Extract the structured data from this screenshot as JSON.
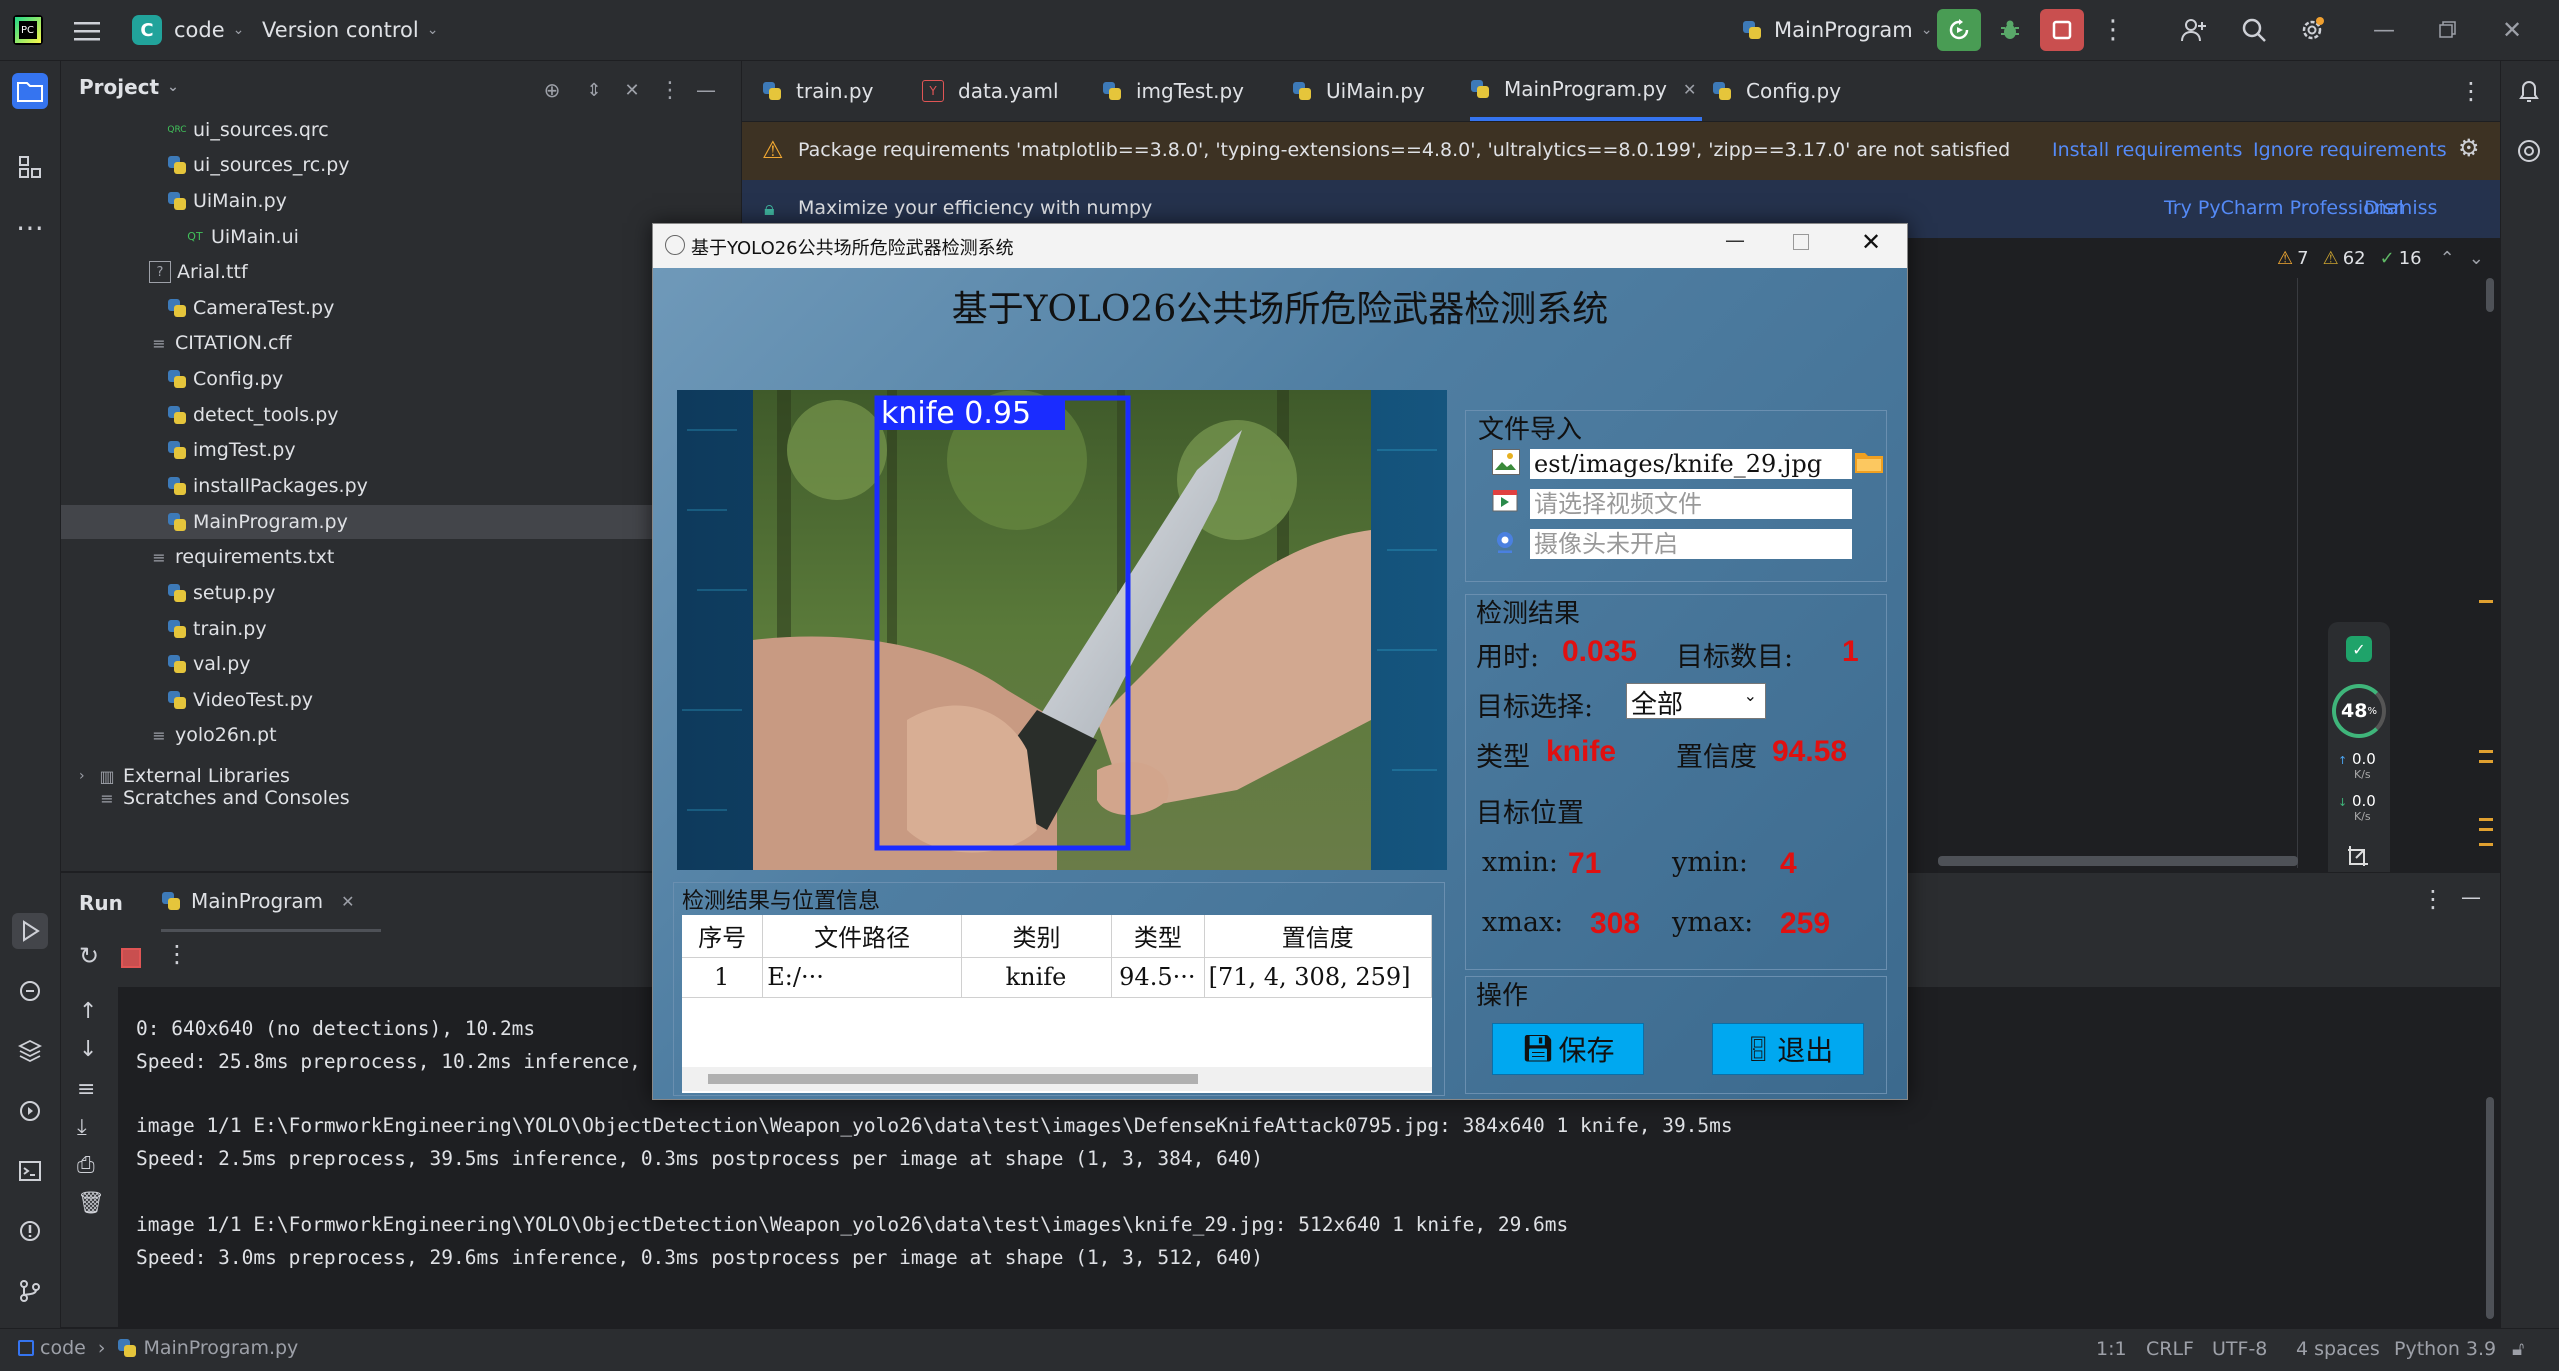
{
  "titlebar": {
    "project_initial": "C",
    "project_name": "code",
    "vcs": "Version control",
    "run_config": "MainProgram"
  },
  "project_panel": {
    "title": "Project",
    "items": [
      {
        "name": "ui_sources.qrc",
        "type": "file"
      },
      {
        "name": "ui_sources_rc.py",
        "type": "py"
      },
      {
        "name": "UiMain.py",
        "type": "py"
      },
      {
        "name": "UiMain.ui",
        "type": "ui"
      },
      {
        "name": "Arial.ttf",
        "type": "font"
      },
      {
        "name": "CameraTest.py",
        "type": "py"
      },
      {
        "name": "CITATION.cff",
        "type": "text"
      },
      {
        "name": "Config.py",
        "type": "py"
      },
      {
        "name": "detect_tools.py",
        "type": "py"
      },
      {
        "name": "imgTest.py",
        "type": "py"
      },
      {
        "name": "installPackages.py",
        "type": "py"
      },
      {
        "name": "MainProgram.py",
        "type": "py",
        "selected": true
      },
      {
        "name": "requirements.txt",
        "type": "text"
      },
      {
        "name": "setup.py",
        "type": "py"
      },
      {
        "name": "train.py",
        "type": "py"
      },
      {
        "name": "val.py",
        "type": "py"
      },
      {
        "name": "VideoTest.py",
        "type": "py"
      },
      {
        "name": "yolo26n.pt",
        "type": "text"
      }
    ],
    "external_libraries": "External Libraries",
    "scratches": "Scratches and Consoles"
  },
  "tabs": [
    {
      "label": "train.py"
    },
    {
      "label": "data.yaml"
    },
    {
      "label": "imgTest.py"
    },
    {
      "label": "UiMain.py"
    },
    {
      "label": "MainProgram.py",
      "active": true
    },
    {
      "label": "Config.py"
    }
  ],
  "banner_requirements": {
    "text": "Package requirements 'matplotlib==3.8.0', 'typing-extensions==4.8.0', 'ultralytics==8.0.199', 'zipp==3.17.0' are not satisfied",
    "install": "Install requirements",
    "ignore": "Ignore requirements"
  },
  "banner_numpy": {
    "text": "Maximize your efficiency with numpy",
    "try": "Try PyCharm Professional",
    "dismiss": "Dismiss"
  },
  "inspections": {
    "warnings": "7",
    "weak": "62",
    "ok": "16"
  },
  "net_widget": {
    "percent": "48",
    "unit": "%",
    "up": "0.0",
    "down": "0.0",
    "rate_unit": "K/s",
    "screenshot": "截图"
  },
  "run_panel": {
    "title": "Run",
    "config_tab": "MainProgram",
    "lines": [
      "0: 640x640 (no detections), 10.2ms",
      "Speed: 25.8ms preprocess, 10.2ms inference,",
      "",
      "image 1/1 E:\\FormworkEngineering\\YOLO\\ObjectDetection\\Weapon_yolo26\\data\\test\\images\\DefenseKnifeAttack0795.jpg: 384x640 1 knife, 39.5ms",
      "Speed: 2.5ms preprocess, 39.5ms inference, 0.3ms postprocess per image at shape (1, 3, 384, 640)",
      "",
      "image 1/1 E:\\FormworkEngineering\\YOLO\\ObjectDetection\\Weapon_yolo26\\data\\test\\images\\knife_29.jpg: 512x640 1 knife, 29.6ms",
      "Speed: 3.0ms preprocess, 29.6ms inference, 0.3ms postprocess per image at shape (1, 3, 512, 640)"
    ]
  },
  "statusbar": {
    "crumb_project": "code",
    "crumb_file": "MainProgram.py",
    "position": "1:1",
    "line_sep": "CRLF",
    "encoding": "UTF-8",
    "indent": "4 spaces",
    "interpreter": "Python 3.9"
  },
  "dialog": {
    "window_title": "基于YOLO26公共场所危险武器检测系统",
    "main_title": "基于YOLO26公共场所危险武器检测系统",
    "detection_label": "knife 0.95",
    "file_import": {
      "title": "文件导入",
      "image_path": "est/images/knife_29.jpg",
      "video_placeholder": "请选择视频文件",
      "camera_placeholder": "摄像头未开启"
    },
    "results": {
      "title": "检测结果",
      "time_label": "用时:",
      "time_value": "0.035",
      "count_label": "目标数目:",
      "count_value": "1",
      "select_label": "目标选择:",
      "select_value": "全部",
      "type_label": "类型",
      "type_value": "knife",
      "conf_label": "置信度",
      "conf_value": "94.58",
      "pos_title": "目标位置",
      "xmin_label": "xmin:",
      "xmin": "71",
      "ymin_label": "ymin:",
      "ymin": "4",
      "xmax_label": "xmax:",
      "xmax": "308",
      "ymax_label": "ymax:",
      "ymax": "259"
    },
    "ops": {
      "title": "操作",
      "save": "保存",
      "exit": "退出"
    },
    "table": {
      "title": "检测结果与位置信息",
      "headers": [
        "序号",
        "文件路径",
        "类别",
        "类型",
        "置信度"
      ],
      "row": [
        "1",
        "E:/···",
        "knife",
        "94.5···",
        "[71, 4, 308, 259]"
      ]
    }
  },
  "colors": {
    "accent": "#3574f0",
    "red_value": "#e01010",
    "button_cyan": "#00a8f0",
    "bbox_blue": "#1a2cff"
  }
}
